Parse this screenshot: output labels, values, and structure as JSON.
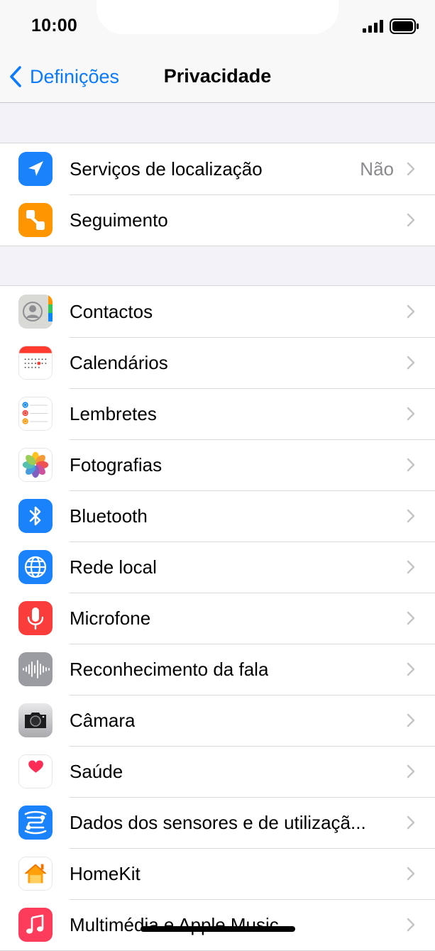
{
  "status_bar": {
    "time": "10:00"
  },
  "nav": {
    "back_label": "Definições",
    "title": "Privacidade"
  },
  "groups": [
    {
      "items": [
        {
          "label": "Serviços de localização",
          "value": "Não",
          "icon": "location-arrow-icon",
          "color": "#1a82fb"
        },
        {
          "label": "Seguimento",
          "value": "",
          "icon": "tracking-icon",
          "color": "#ff9500"
        }
      ]
    },
    {
      "items": [
        {
          "label": "Contactos",
          "icon": "contacts-icon"
        },
        {
          "label": "Calendários",
          "icon": "calendar-icon"
        },
        {
          "label": "Lembretes",
          "icon": "reminders-icon"
        },
        {
          "label": "Fotografias",
          "icon": "photos-icon"
        },
        {
          "label": "Bluetooth",
          "icon": "bluetooth-icon",
          "color": "#1a82fb"
        },
        {
          "label": "Rede local",
          "icon": "globe-icon",
          "color": "#1a82fb"
        },
        {
          "label": "Microfone",
          "icon": "microphone-icon",
          "color": "#fa3d3b"
        },
        {
          "label": "Reconhecimento da fala",
          "icon": "waveform-icon",
          "color": "#9b9ba2"
        },
        {
          "label": "Câmara",
          "icon": "camera-icon"
        },
        {
          "label": "Saúde",
          "icon": "health-heart-icon",
          "color": "#ff2d55"
        },
        {
          "label": "Dados dos sensores e de utilizaçã...",
          "icon": "sensor-data-icon",
          "color": "#1a82fb"
        },
        {
          "label": "HomeKit",
          "icon": "home-icon",
          "color": "#ff9f0a"
        },
        {
          "label": "Multimédia e Apple Music",
          "icon": "music-note-icon",
          "color": "#fc3c5a"
        }
      ]
    }
  ]
}
